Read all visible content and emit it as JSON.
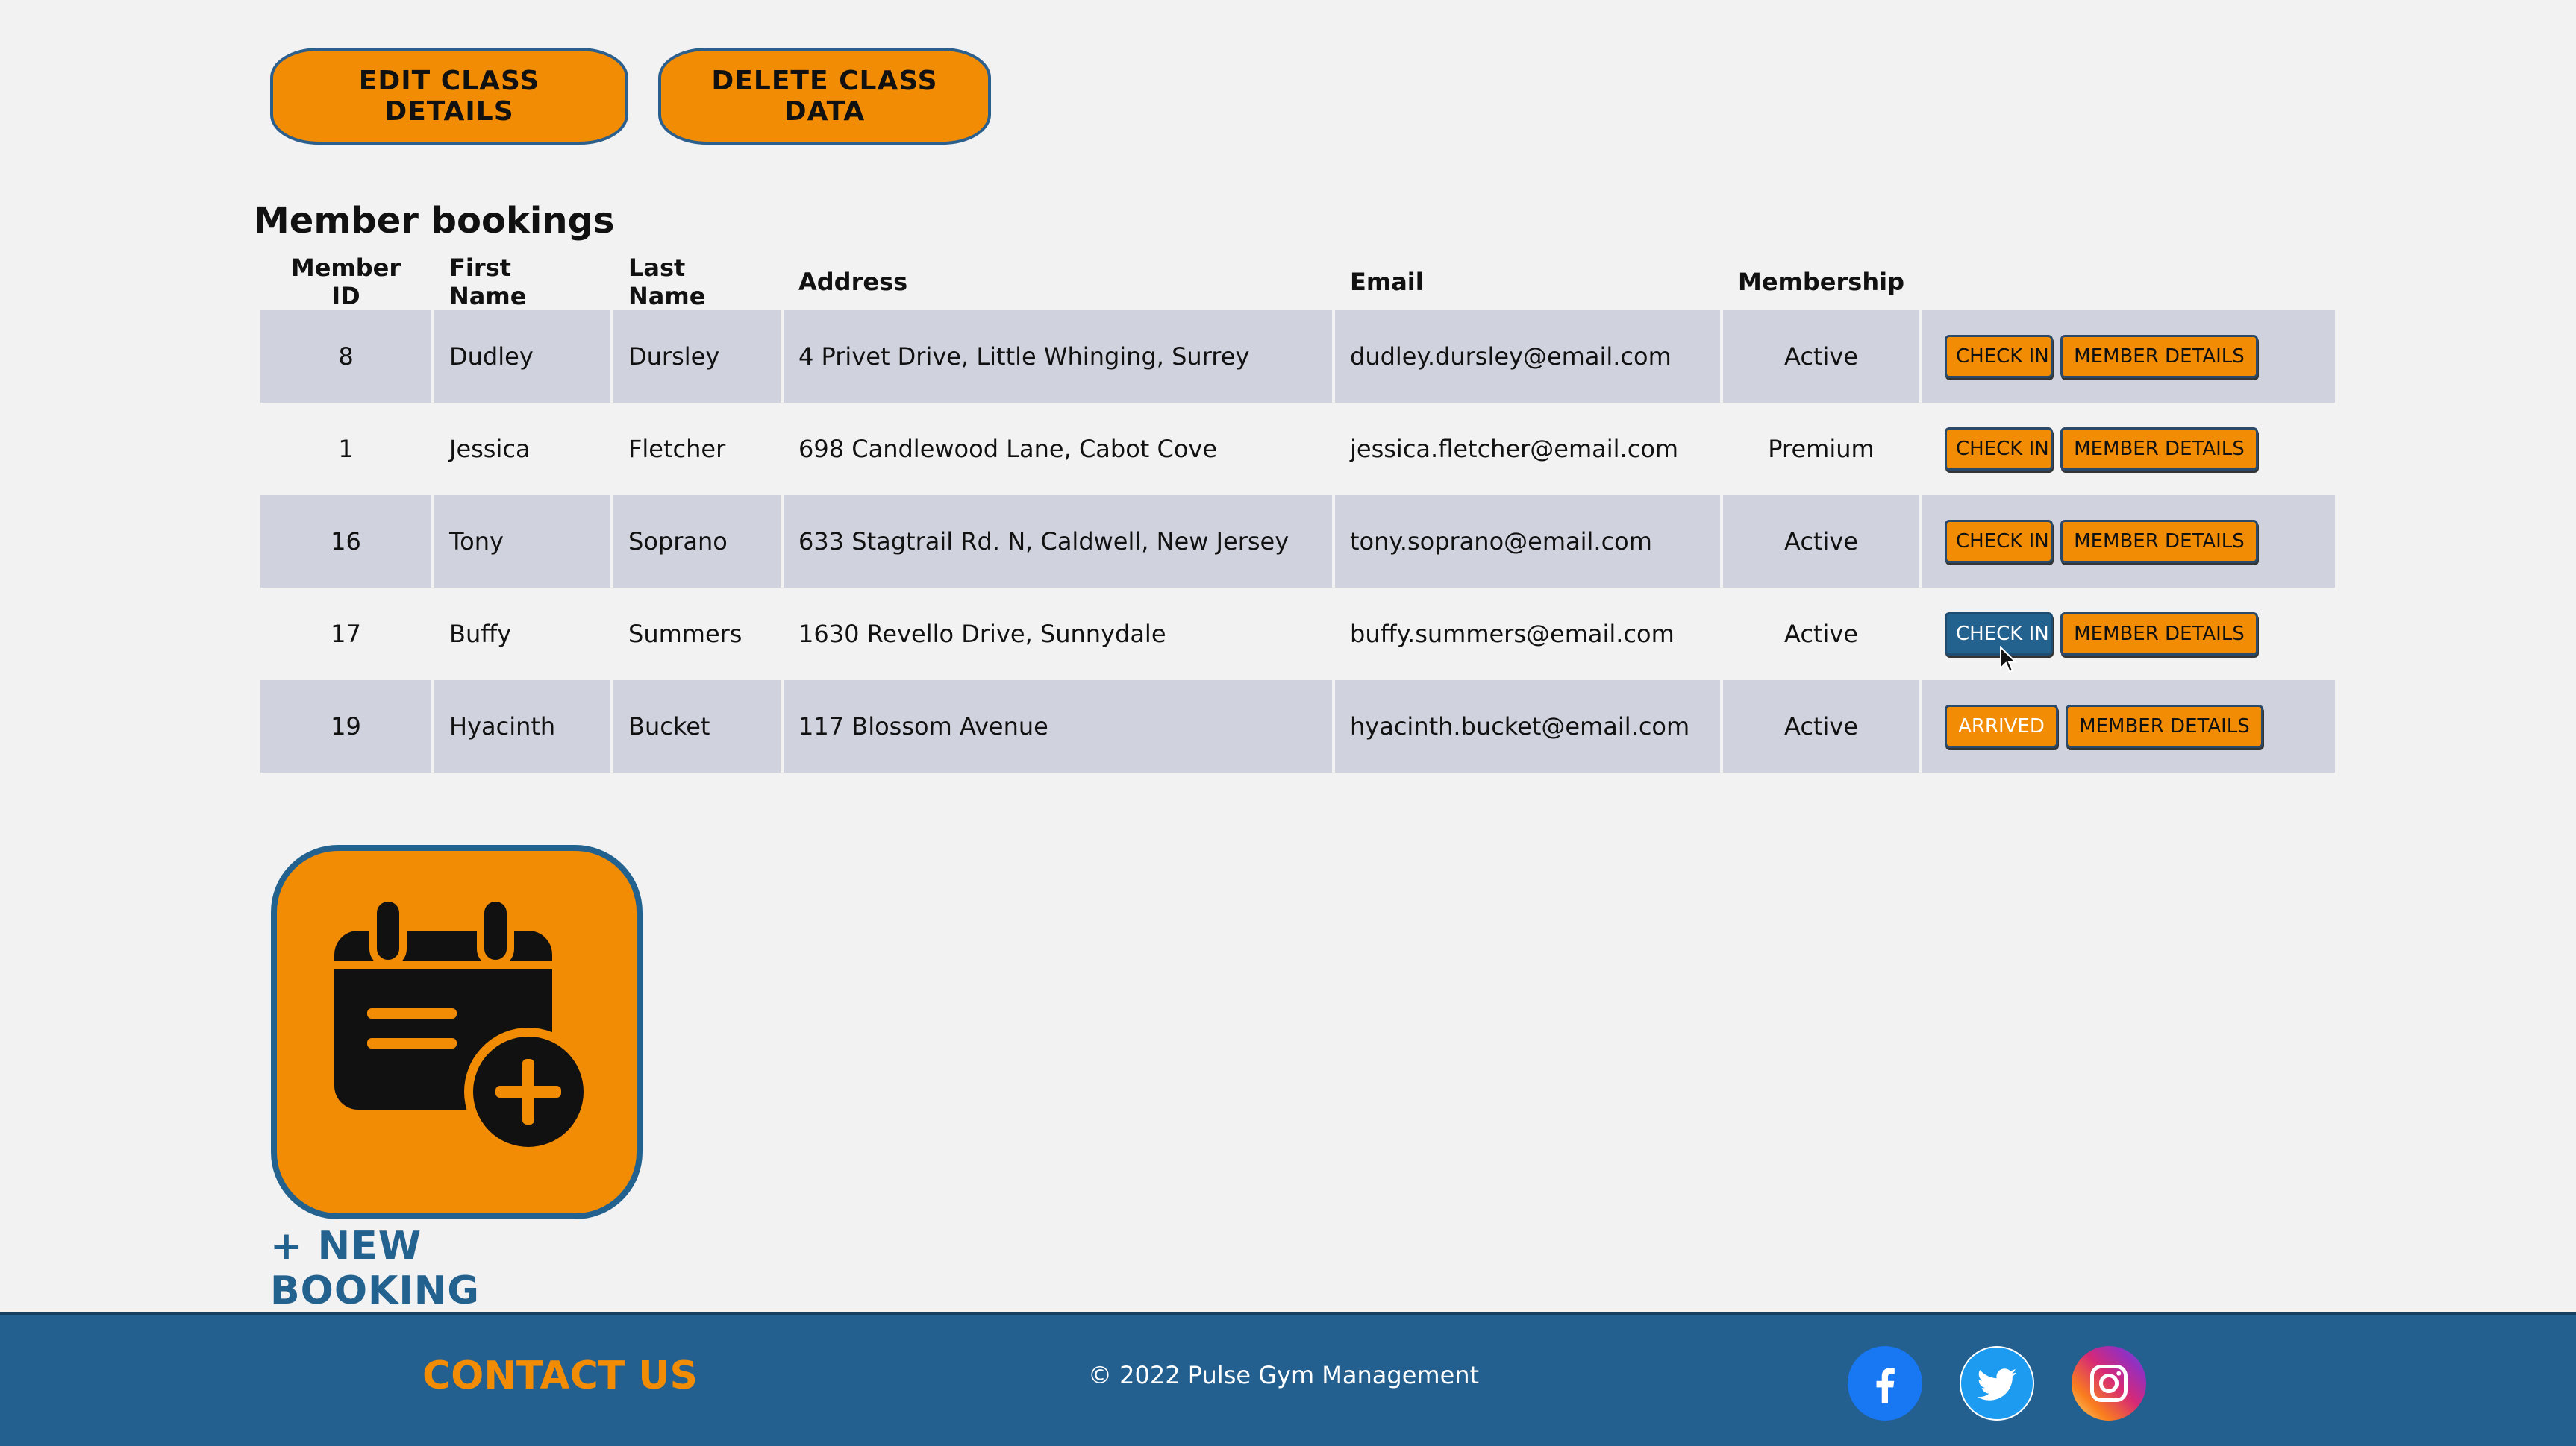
{
  "actions": {
    "edit_label": "EDIT CLASS DETAILS",
    "delete_label": "DELETE CLASS DATA"
  },
  "bookings": {
    "title": "Member bookings",
    "headers": {
      "member_id": "Member ID",
      "first_name": "First Name",
      "last_name": "Last Name",
      "address": "Address",
      "email": "Email",
      "membership": "Membership"
    },
    "rows": [
      {
        "id": "8",
        "first": "Dudley",
        "last": "Dursley",
        "address": "4 Privet Drive, Little Whinging, Surrey",
        "email": "dudley.dursley@email.com",
        "membership": "Active",
        "status_label": "CHECK IN",
        "details_label": "MEMBER DETAILS"
      },
      {
        "id": "1",
        "first": "Jessica",
        "last": "Fletcher",
        "address": "698 Candlewood Lane, Cabot Cove",
        "email": "jessica.fletcher@email.com",
        "membership": "Premium",
        "status_label": "CHECK IN",
        "details_label": "MEMBER DETAILS"
      },
      {
        "id": "16",
        "first": "Tony",
        "last": "Soprano",
        "address": "633 Stagtrail Rd. N, Caldwell, New Jersey",
        "email": "tony.soprano@email.com",
        "membership": "Active",
        "status_label": "CHECK IN",
        "details_label": "MEMBER DETAILS"
      },
      {
        "id": "17",
        "first": "Buffy",
        "last": "Summers",
        "address": "1630 Revello Drive, Sunnydale",
        "email": "buffy.summers@email.com",
        "membership": "Active",
        "status_label": "CHECK IN",
        "details_label": "MEMBER DETAILS"
      },
      {
        "id": "19",
        "first": "Hyacinth",
        "last": "Bucket",
        "address": "117 Blossom Avenue",
        "email": "hyacinth.bucket@email.com",
        "membership": "Active",
        "status_label": "ARRIVED",
        "details_label": "MEMBER DETAILS"
      }
    ]
  },
  "new_booking": {
    "label": "+ NEW BOOKING",
    "icon": "calendar-add-icon"
  },
  "footer": {
    "contact": "CONTACT US",
    "copyright": "© 2022 Pulse Gym Management",
    "social": [
      "facebook-icon",
      "twitter-icon",
      "instagram-icon"
    ]
  },
  "colors": {
    "accent": "#f28c05",
    "primary": "#23628f",
    "row_stripe": "#d0d3de",
    "background": "#f2f2f3"
  }
}
